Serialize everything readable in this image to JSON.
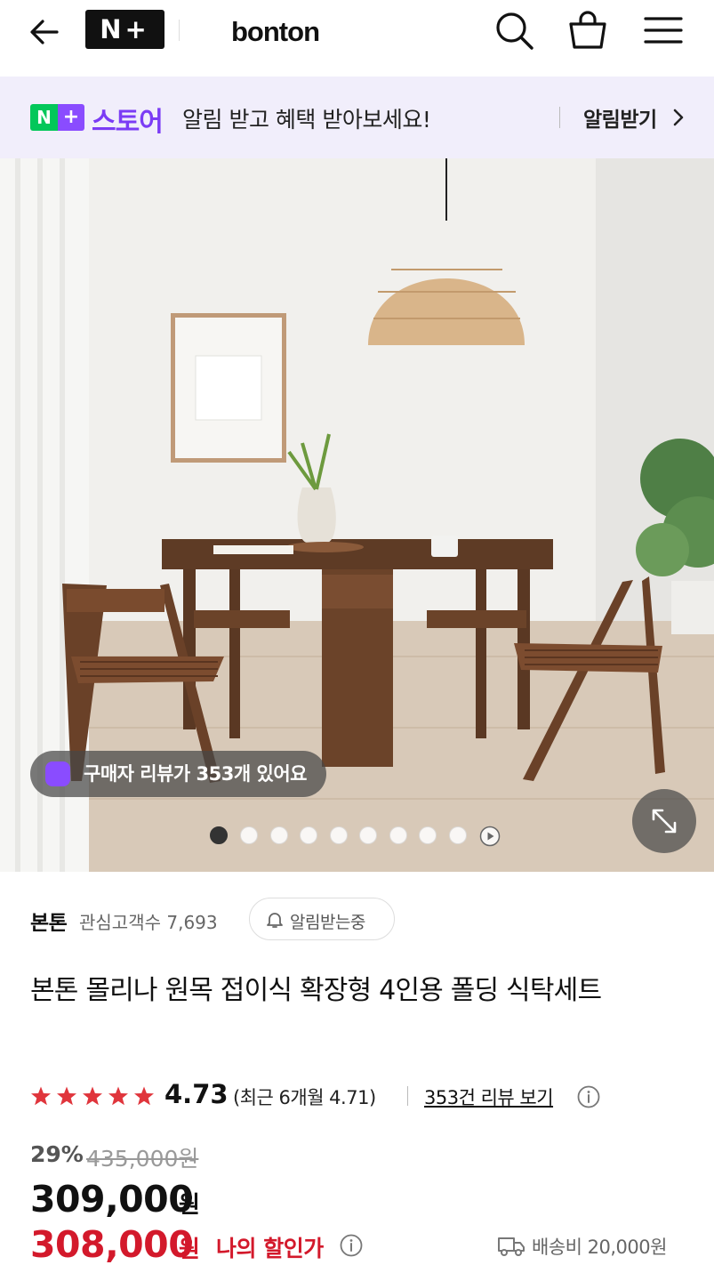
{
  "header": {
    "logo_badge": "N+",
    "brand": "bonton",
    "icons": [
      "back-arrow-icon",
      "search-icon",
      "shopping-bag-icon",
      "menu-icon"
    ]
  },
  "banner": {
    "badge_n": "N",
    "badge_plus": "+",
    "store_label": "스토어",
    "message": "알림 받고 혜택 받아보세요!",
    "action": "알림받기"
  },
  "hero": {
    "review_pill": "구매자 리뷰가 353개 있어요",
    "slide_count": 9,
    "active_slide": 1
  },
  "seller": {
    "name": "본톤",
    "fans_label": "관심고객수 7,693",
    "alarm_button": "알림받는중"
  },
  "product": {
    "title": "본톤 몰리나 원목 접이식 확장형 4인용 폴딩 식탁세트",
    "rating": "4.73",
    "recent_rating": "(최근 6개월 4.71)",
    "reviews_link": "353건 리뷰 보기",
    "discount": "29%",
    "original_price": "435,000원",
    "price": "309,000",
    "currency": "원",
    "my_price": "308,000",
    "my_price_label": "나의 할인가",
    "shipping": "배송비 20,000원"
  },
  "colors": {
    "naver_green": "#03c75a",
    "store_purple": "#7b3cf5",
    "sale_red": "#d3192b",
    "star_red": "#e0353c"
  }
}
